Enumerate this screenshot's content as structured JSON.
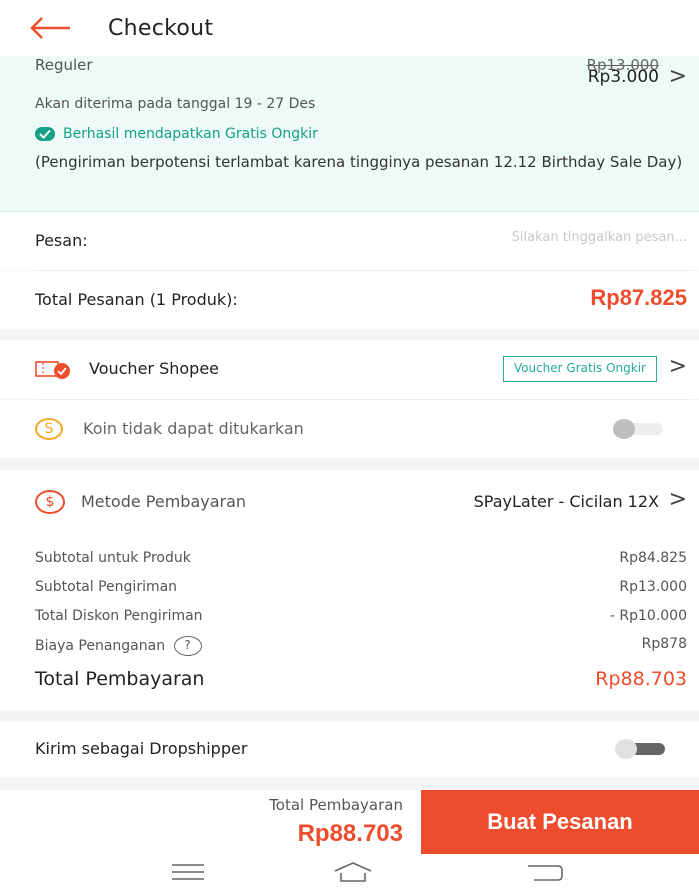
{
  "header": {
    "title": "Checkout",
    "back_icon": "arrow-left-icon"
  },
  "shipping": {
    "cut_label": "Reguler",
    "cut_price": "Rp13.000",
    "price": "Rp3.000",
    "delivery_date": "Akan diterima pada tanggal 19 - 27 Des",
    "free_shipping": "Berhasil mendapatkan Gratis Ongkir",
    "note": "(Pengiriman berpotensi terlambat karena tingginya pesanan 12.12 Birthday Sale Day)"
  },
  "message": {
    "label": "Pesan:",
    "placeholder": "Silakan tinggalkan pesan..."
  },
  "order_total": {
    "label": "Total Pesanan (1 Produk):",
    "value": "Rp87.825"
  },
  "voucher": {
    "label": "Voucher Shopee",
    "tag": "Voucher Gratis Ongkir"
  },
  "coins": {
    "label": "Koin tidak dapat ditukarkan",
    "toggle_on": false
  },
  "payment": {
    "label": "Metode Pembayaran",
    "value": "SPayLater - Cicilan 12X",
    "summary": [
      {
        "label": "Subtotal untuk Produk",
        "value": "Rp84.825"
      },
      {
        "label": "Subtotal Pengiriman",
        "value": "Rp13.000"
      },
      {
        "label": "Total Diskon Pengiriman",
        "value": "- Rp10.000"
      },
      {
        "label": "Biaya Penanganan",
        "value": "Rp878"
      }
    ],
    "total_label": "Total Pembayaran",
    "total_value": "Rp88.703"
  },
  "dropshipper": {
    "label": "Kirim sebagai Dropshipper",
    "toggle_on": false
  },
  "bottom_bar": {
    "label": "Total Pembayaran",
    "total": "Rp88.703",
    "button": "Buat Pesanan"
  },
  "colors": {
    "accent": "#ee4d2d",
    "teal": "#26aa99",
    "shipping_bg": "#eefaf8"
  }
}
